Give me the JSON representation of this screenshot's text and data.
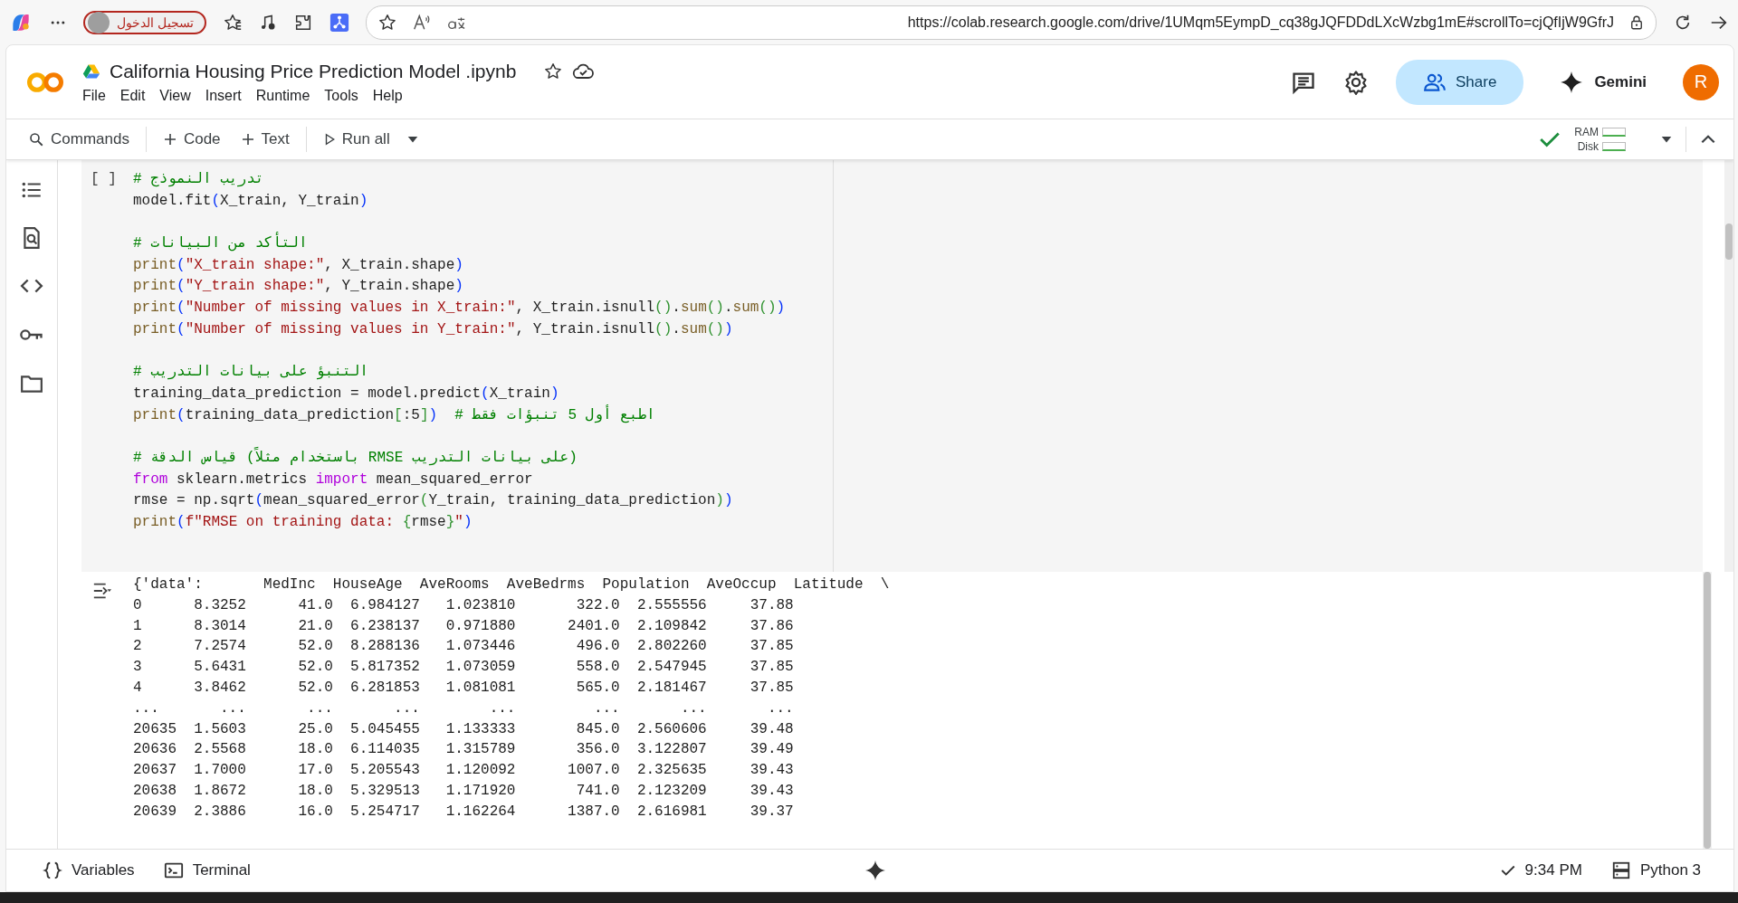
{
  "browser": {
    "profile_label": "تسجيل الدخول",
    "url": "https://colab.research.google.com/drive/1UMqm5EympD_cq38gJQFDDdLXcWzbg1mE#scrollTo=cjQfIjW9GfrJ"
  },
  "notebook": {
    "title": "California Housing Price Prediction Model .ipynb"
  },
  "menu": [
    "File",
    "Edit",
    "View",
    "Insert",
    "Runtime",
    "Tools",
    "Help"
  ],
  "header_actions": {
    "share": "Share",
    "gemini": "Gemini",
    "avatar": "R"
  },
  "toolbar": {
    "commands": "Commands",
    "add_code": "Code",
    "add_text": "Text",
    "run_all": "Run all",
    "ram_label": "RAM",
    "disk_label": "Disk",
    "connected": true
  },
  "code_cell": {
    "run_marker": "[ ]",
    "lines": [
      {
        "kind": "code",
        "tokens": [
          {
            "kind": "comment",
            "text": "# تدريب النموذج"
          }
        ]
      },
      {
        "kind": "code",
        "tokens": [
          {
            "kind": "plain",
            "text": "model.fit"
          },
          {
            "kind": "paren1",
            "text": "("
          },
          {
            "kind": "plain",
            "text": "X_train, Y_train"
          },
          {
            "kind": "paren1",
            "text": ")"
          }
        ]
      },
      {
        "kind": "blank"
      },
      {
        "kind": "code",
        "tokens": [
          {
            "kind": "comment",
            "text": "# التأكد من البيانات"
          }
        ]
      },
      {
        "kind": "code",
        "tokens": [
          {
            "kind": "func",
            "text": "print"
          },
          {
            "kind": "paren1",
            "text": "("
          },
          {
            "kind": "string",
            "text": "\"X_train shape:\""
          },
          {
            "kind": "plain",
            "text": ", X_train.shape"
          },
          {
            "kind": "paren1",
            "text": ")"
          }
        ]
      },
      {
        "kind": "code",
        "tokens": [
          {
            "kind": "func",
            "text": "print"
          },
          {
            "kind": "paren1",
            "text": "("
          },
          {
            "kind": "string",
            "text": "\"Y_train shape:\""
          },
          {
            "kind": "plain",
            "text": ", Y_train.shape"
          },
          {
            "kind": "paren1",
            "text": ")"
          }
        ]
      },
      {
        "kind": "code",
        "tokens": [
          {
            "kind": "func",
            "text": "print"
          },
          {
            "kind": "paren1",
            "text": "("
          },
          {
            "kind": "string",
            "text": "\"Number of missing values in X_train:\""
          },
          {
            "kind": "plain",
            "text": ", X_train.isnull"
          },
          {
            "kind": "paren2",
            "text": "()"
          },
          {
            "kind": "plain",
            "text": "."
          },
          {
            "kind": "func",
            "text": "sum"
          },
          {
            "kind": "paren2",
            "text": "()"
          },
          {
            "kind": "plain",
            "text": "."
          },
          {
            "kind": "func",
            "text": "sum"
          },
          {
            "kind": "paren2",
            "text": "()"
          },
          {
            "kind": "paren1",
            "text": ")"
          }
        ]
      },
      {
        "kind": "code",
        "tokens": [
          {
            "kind": "func",
            "text": "print"
          },
          {
            "kind": "paren1",
            "text": "("
          },
          {
            "kind": "string",
            "text": "\"Number of missing values in Y_train:\""
          },
          {
            "kind": "plain",
            "text": ", Y_train.isnull"
          },
          {
            "kind": "paren2",
            "text": "()"
          },
          {
            "kind": "plain",
            "text": "."
          },
          {
            "kind": "func",
            "text": "sum"
          },
          {
            "kind": "paren2",
            "text": "()"
          },
          {
            "kind": "paren1",
            "text": ")"
          }
        ]
      },
      {
        "kind": "blank"
      },
      {
        "kind": "code",
        "tokens": [
          {
            "kind": "comment",
            "text": "# التنبؤ على بيانات التدريب"
          }
        ]
      },
      {
        "kind": "code",
        "tokens": [
          {
            "kind": "plain",
            "text": "training_data_prediction = model.predict"
          },
          {
            "kind": "paren1",
            "text": "("
          },
          {
            "kind": "plain",
            "text": "X_train"
          },
          {
            "kind": "paren1",
            "text": ")"
          }
        ]
      },
      {
        "kind": "code",
        "tokens": [
          {
            "kind": "func",
            "text": "print"
          },
          {
            "kind": "paren1",
            "text": "("
          },
          {
            "kind": "plain",
            "text": "training_data_prediction"
          },
          {
            "kind": "paren2",
            "text": "["
          },
          {
            "kind": "plain",
            "text": ":5"
          },
          {
            "kind": "paren2",
            "text": "]"
          },
          {
            "kind": "paren1",
            "text": ")"
          },
          {
            "kind": "comment",
            "text": "  # اطبع أول 5 تنبؤات فقط"
          }
        ]
      },
      {
        "kind": "blank"
      },
      {
        "kind": "code",
        "tokens": [
          {
            "kind": "comment",
            "text": "# قياس الدقة (باستخدام مثلاً RMSE على بيانات التدريب)"
          }
        ]
      },
      {
        "kind": "code",
        "tokens": [
          {
            "kind": "keyword",
            "text": "from"
          },
          {
            "kind": "plain",
            "text": " sklearn.metrics "
          },
          {
            "kind": "keyword",
            "text": "import"
          },
          {
            "kind": "plain",
            "text": " mean_squared_error"
          }
        ]
      },
      {
        "kind": "code",
        "tokens": [
          {
            "kind": "plain",
            "text": "rmse = np.sqrt"
          },
          {
            "kind": "paren1",
            "text": "("
          },
          {
            "kind": "plain",
            "text": "mean_squared_error"
          },
          {
            "kind": "paren2",
            "text": "("
          },
          {
            "kind": "plain",
            "text": "Y_train, training_data_prediction"
          },
          {
            "kind": "paren2",
            "text": ")"
          },
          {
            "kind": "paren1",
            "text": ")"
          }
        ]
      },
      {
        "kind": "code",
        "tokens": [
          {
            "kind": "func",
            "text": "print"
          },
          {
            "kind": "paren1",
            "text": "("
          },
          {
            "kind": "string",
            "text": "f\"RMSE on training data: "
          },
          {
            "kind": "paren2",
            "text": "{"
          },
          {
            "kind": "plain",
            "text": "rmse"
          },
          {
            "kind": "paren2",
            "text": "}"
          },
          {
            "kind": "string",
            "text": "\""
          },
          {
            "kind": "paren1",
            "text": ")"
          }
        ]
      }
    ]
  },
  "output": {
    "lines": [
      "{'data':       MedInc  HouseAge  AveRooms  AveBedrms  Population  AveOccup  Latitude  \\",
      "0      8.3252      41.0  6.984127   1.023810       322.0  2.555556     37.88",
      "1      8.3014      21.0  6.238137   0.971880      2401.0  2.109842     37.86",
      "2      7.2574      52.0  8.288136   1.073446       496.0  2.802260     37.85",
      "3      5.6431      52.0  5.817352   1.073059       558.0  2.547945     37.85",
      "4      3.8462      52.0  6.281853   1.081081       565.0  2.181467     37.85",
      "...       ...       ...       ...        ...         ...       ...       ...",
      "20635  1.5603      25.0  5.045455   1.133333       845.0  2.560606     39.48",
      "20636  2.5568      18.0  6.114035   1.315789       356.0  3.122807     39.49",
      "20637  1.7000      17.0  5.205543   1.120092      1007.0  2.325635     39.43",
      "20638  1.8672      18.0  5.329513   1.171920       741.0  2.123209     39.43",
      "20639  2.3886      16.0  5.254717   1.162264      1387.0  2.616981     39.37"
    ]
  },
  "status_bar": {
    "variables": "Variables",
    "terminal": "Terminal",
    "time": "9:34 PM",
    "runtime": "Python 3"
  }
}
